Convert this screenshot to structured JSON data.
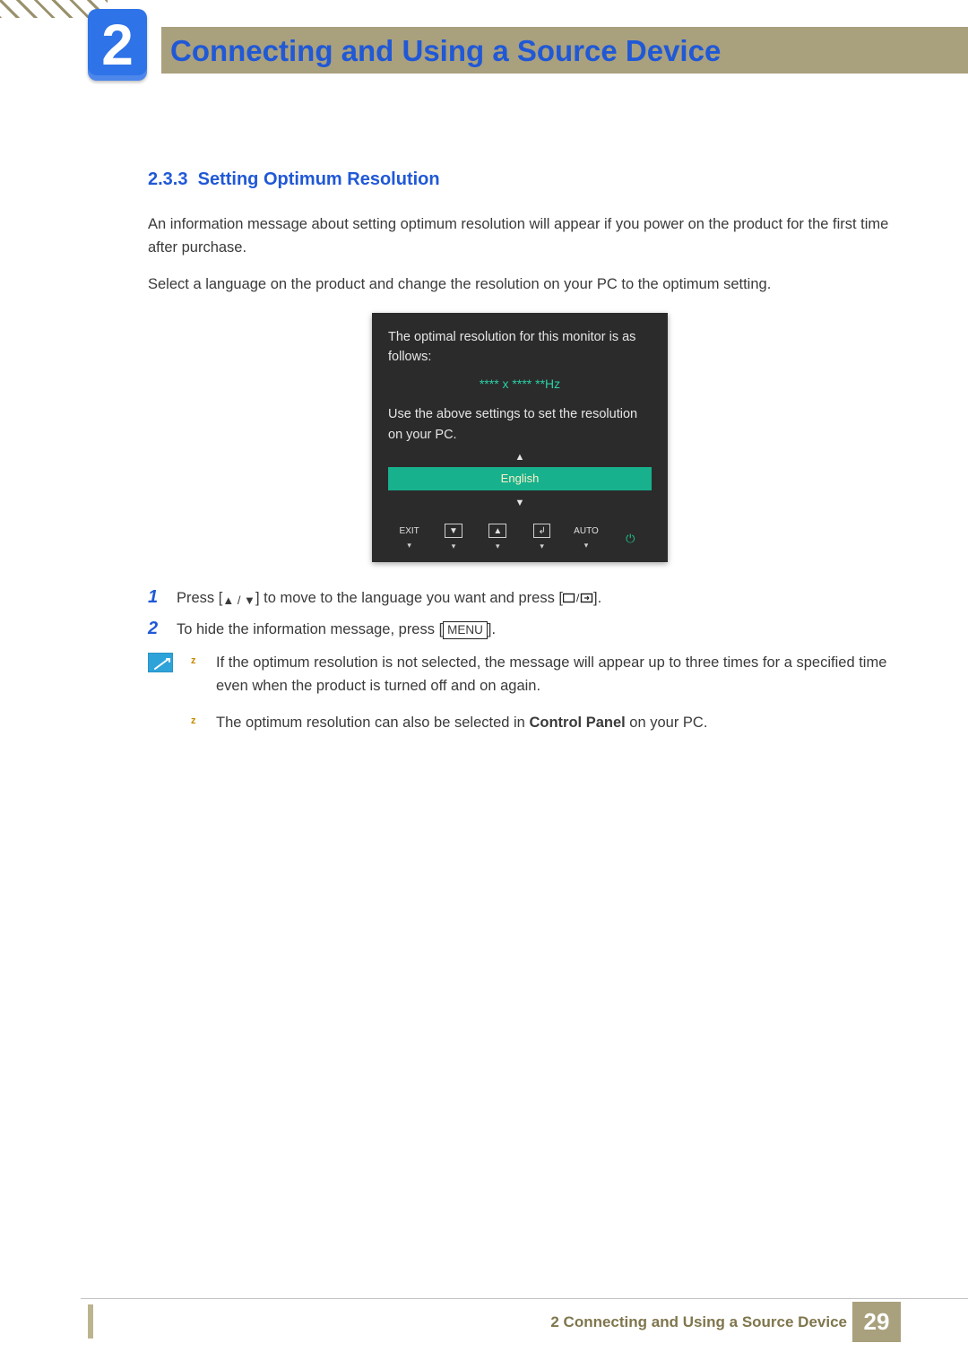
{
  "chapter": {
    "number": "2",
    "title": "Connecting and Using a Source Device"
  },
  "section": {
    "number": "2.3.3",
    "title": "Setting Optimum Resolution"
  },
  "intro": {
    "p1": "An information message about setting optimum resolution will appear if you power on the product for the first time after purchase.",
    "p2": "Select a language on the product and change the resolution on your PC to the optimum setting."
  },
  "osd": {
    "line1": "The optimal resolution for this monitor is as follows:",
    "resolution": "**** x ****  **Hz",
    "line2": "Use the above settings to set the resolution on your PC.",
    "language": "English",
    "buttons": {
      "exit": "EXIT",
      "auto": "AUTO"
    },
    "arrows": {
      "up": "▲",
      "down": "▼"
    }
  },
  "steps": {
    "s1": {
      "num": "1",
      "pre": "Press [",
      "mid": "] to move to the language you want and press [",
      "post": "]."
    },
    "s2": {
      "num": "2",
      "pre": "To hide the information message, press [",
      "menu": "MENU",
      "post": "]."
    }
  },
  "notes": {
    "n1a": "If the optimum resolution is not selected, the message will appear up to three times for a specified time even when the product is turned off and on again.",
    "n2a": "The optimum resolution can also be selected in ",
    "n2b": "Control Panel",
    "n2c": " on your PC."
  },
  "footer": {
    "label": "2 Connecting and Using a Source Device",
    "page": "29"
  },
  "bullets": {
    "z": "z"
  }
}
